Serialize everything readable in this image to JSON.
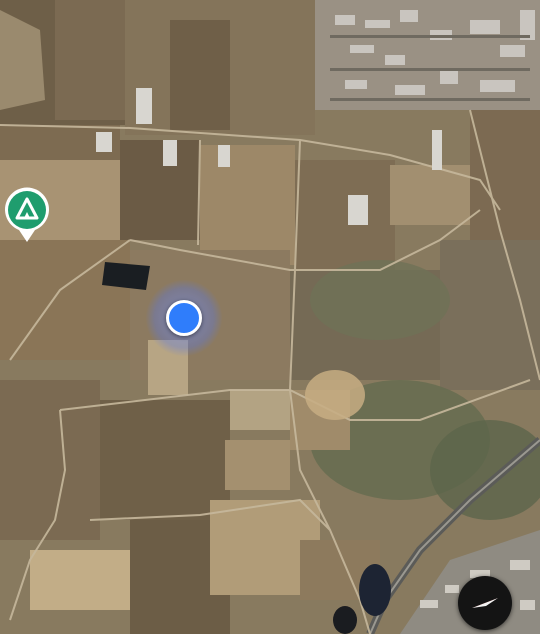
{
  "map": {
    "view": "satellite",
    "features": [
      "farm-fields",
      "village",
      "road",
      "ponds",
      "greenhouses"
    ]
  },
  "markers": {
    "campsite": {
      "icon": "campsite-tent-icon",
      "color": "#1f9d6e"
    },
    "current_location": {
      "icon": "location-dot",
      "color": "#2f7dfb"
    }
  },
  "controls": {
    "compass": {
      "icon": "compass-needle-icon",
      "needle_color": "#e0362c"
    }
  }
}
